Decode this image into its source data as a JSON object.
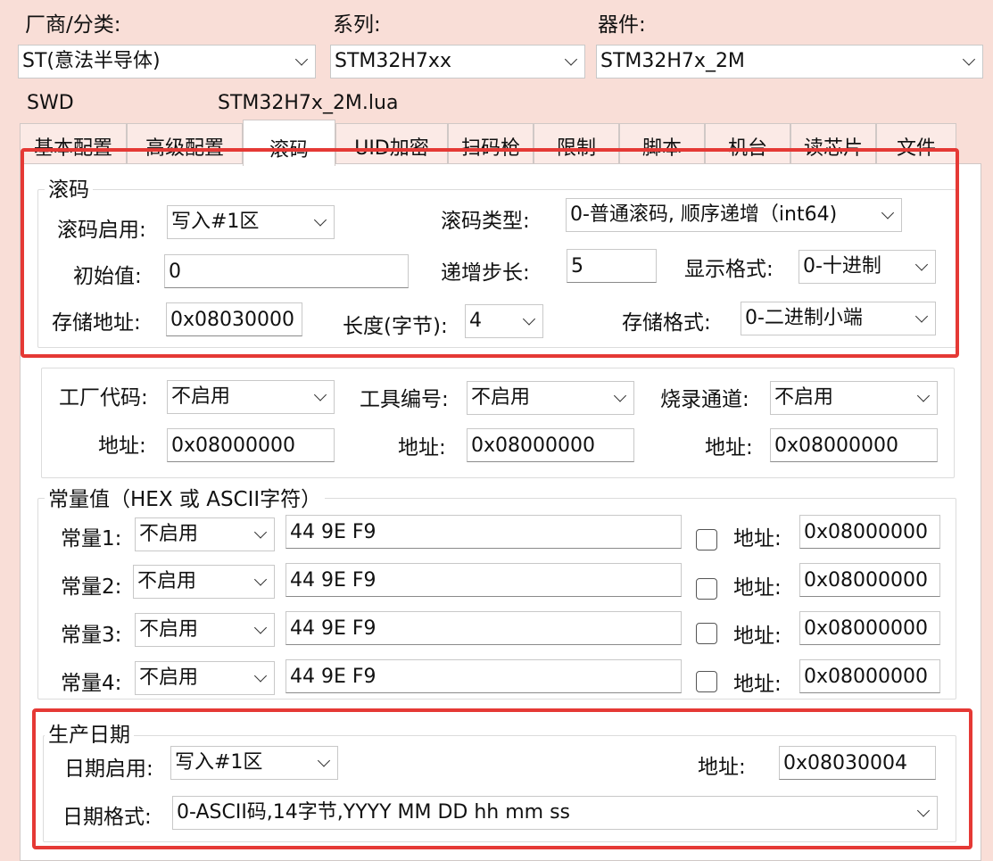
{
  "top": {
    "vendor_label": "厂商/分类:",
    "vendor_value": "ST(意法半导体)",
    "series_label": "系列:",
    "series_value": "STM32H7xx",
    "device_label": "器件:",
    "device_value": "STM32H7x_2M",
    "protocol": "SWD",
    "script_file": "STM32H7x_2M.lua"
  },
  "tabs": [
    "基本配置",
    "高级配置",
    "滚码",
    "UID加密",
    "扫码枪",
    "限制",
    "脚本",
    "机台",
    "读芯片",
    "文件"
  ],
  "rolling": {
    "title": "滚码",
    "enable_label": "滚码启用:",
    "enable_value": "写入#1区",
    "type_label": "滚码类型:",
    "type_value": "0-普通滚码, 顺序递增（int64)",
    "init_label": "初始值:",
    "init_value": "0",
    "step_label": "递增步长:",
    "step_value": "5",
    "display_label": "显示格式:",
    "display_value": "0-十进制",
    "addr_label": "存储地址:",
    "addr_value": "0x08030000",
    "len_label": "长度(字节):",
    "len_value": "4",
    "store_label": "存储格式:",
    "store_value": "0-二进制小端"
  },
  "factory": {
    "factory_label": "工厂代码:",
    "factory_value": "不启用",
    "tool_label": "工具编号:",
    "tool_value": "不启用",
    "channel_label": "烧录通道:",
    "channel_value": "不启用",
    "addr_label": "地址:",
    "addr1": "0x08000000",
    "addr2": "0x08000000",
    "addr3": "0x08000000"
  },
  "constants": {
    "title": "常量值（HEX 或 ASCII字符）",
    "addr_label": "地址:",
    "rows": [
      {
        "label": "常量1:",
        "mode": "不启用",
        "value": "44 9E F9",
        "addr": "0x08000000"
      },
      {
        "label": "常量2:",
        "mode": "不启用",
        "value": "44 9E F9",
        "addr": "0x08000000"
      },
      {
        "label": "常量3:",
        "mode": "不启用",
        "value": "44 9E F9",
        "addr": "0x08000000"
      },
      {
        "label": "常量4:",
        "mode": "不启用",
        "value": "44 9E F9",
        "addr": "0x08000000"
      }
    ]
  },
  "date": {
    "title": "生产日期",
    "enable_label": "日期启用:",
    "enable_value": "写入#1区",
    "addr_label": "地址:",
    "addr_value": "0x08030004",
    "format_label": "日期格式:",
    "format_value": "0-ASCII码,14字节,YYYY MM DD hh mm ss"
  },
  "colors": {
    "window_bg": "#f9ded7",
    "highlight": "#e53935"
  }
}
